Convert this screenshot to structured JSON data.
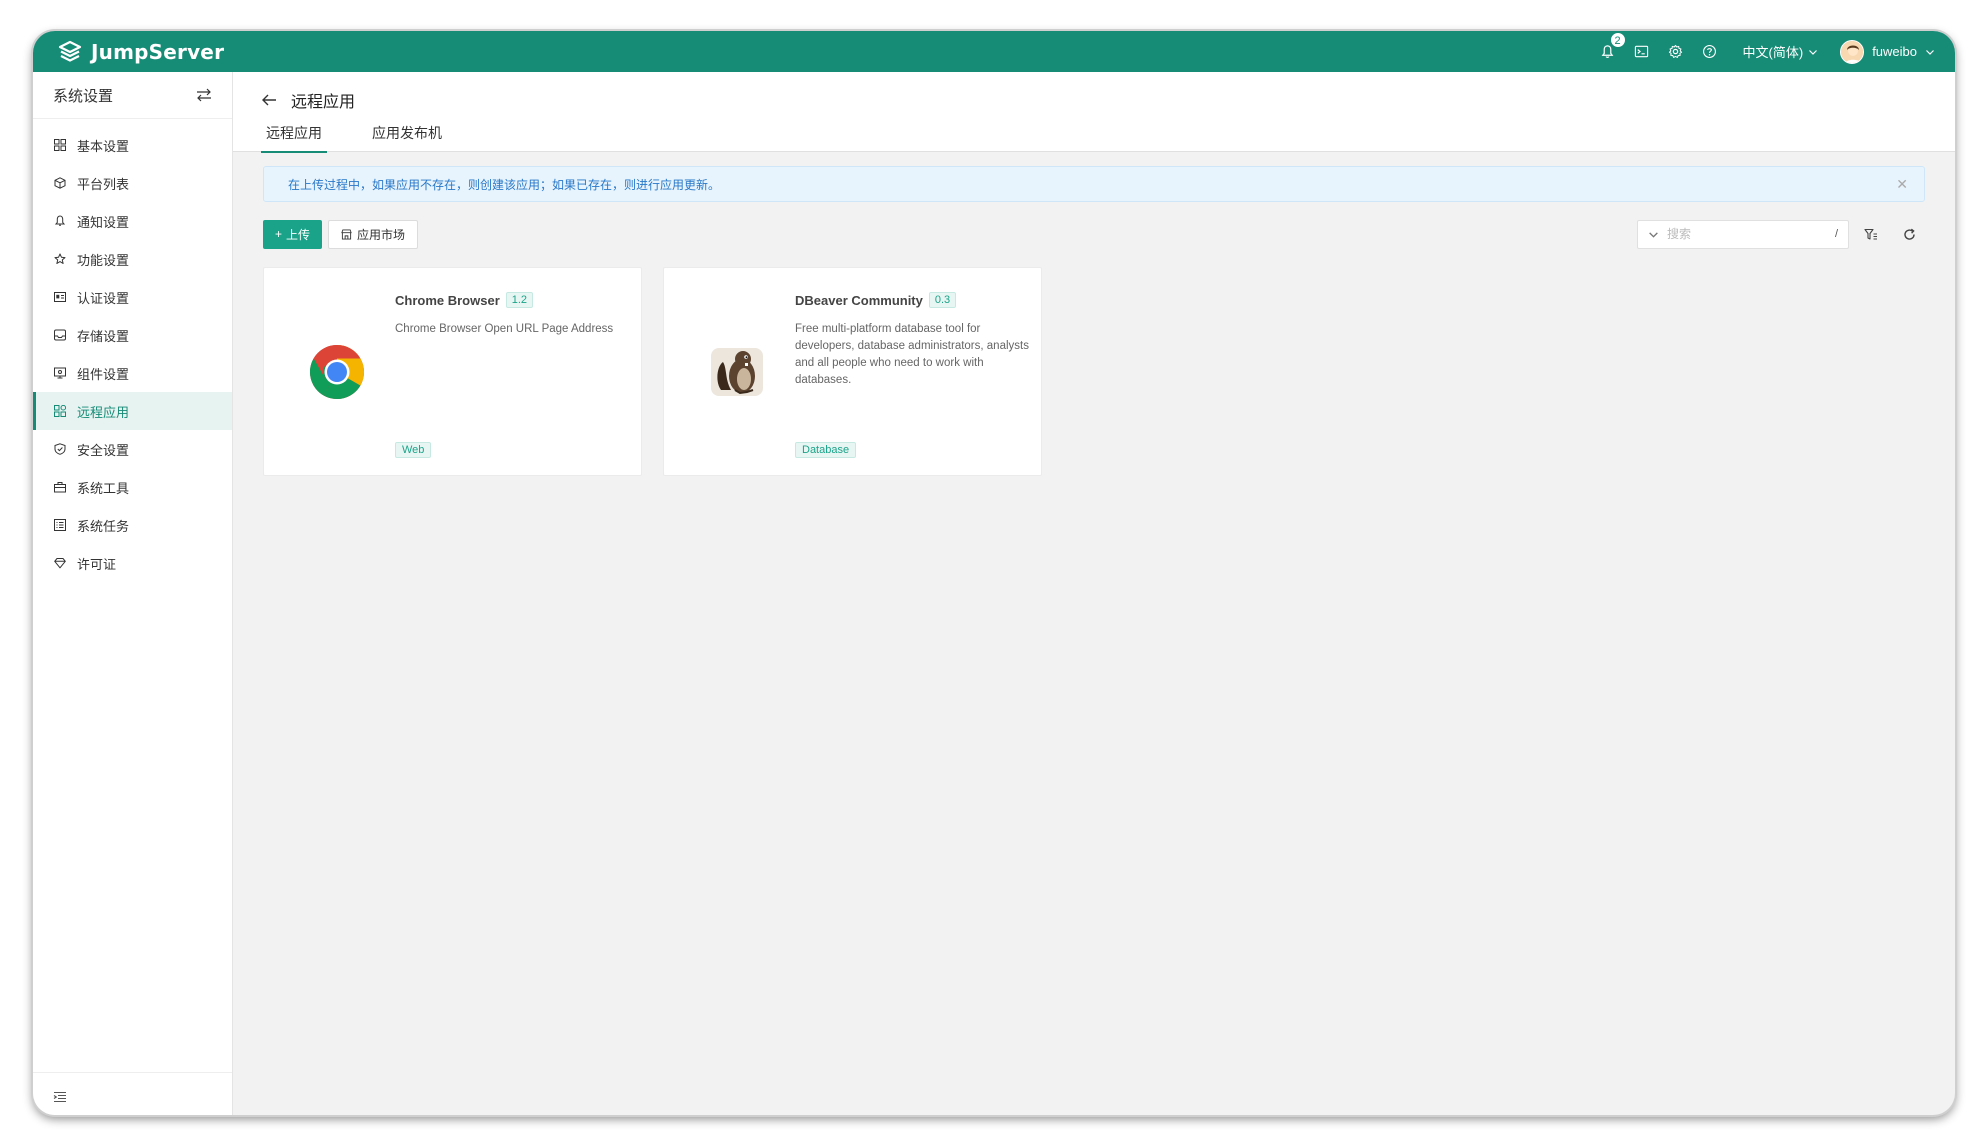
{
  "app": {
    "brand": "JumpServer"
  },
  "topbar": {
    "notification_count": "2",
    "language": "中文(简体)",
    "username": "fuweibo",
    "icons": [
      "bell-icon",
      "terminal-icon",
      "gear-icon",
      "help-icon"
    ]
  },
  "sidebar": {
    "title": "系统设置",
    "items": [
      {
        "label": "基本设置",
        "icon": "grid-icon"
      },
      {
        "label": "平台列表",
        "icon": "cube-icon"
      },
      {
        "label": "通知设置",
        "icon": "bell-icon"
      },
      {
        "label": "功能设置",
        "icon": "star-icon"
      },
      {
        "label": "认证设置",
        "icon": "id-card-icon"
      },
      {
        "label": "存储设置",
        "icon": "inbox-icon"
      },
      {
        "label": "组件设置",
        "icon": "monitor-icon"
      },
      {
        "label": "远程应用",
        "icon": "apps-icon",
        "active": true
      },
      {
        "label": "安全设置",
        "icon": "shield-icon"
      },
      {
        "label": "系统工具",
        "icon": "toolbox-icon"
      },
      {
        "label": "系统任务",
        "icon": "tasks-icon"
      },
      {
        "label": "许可证",
        "icon": "diamond-icon"
      }
    ]
  },
  "header": {
    "title": "远程应用",
    "tabs": [
      {
        "label": "远程应用",
        "active": true
      },
      {
        "label": "应用发布机",
        "active": false
      }
    ]
  },
  "alert": {
    "text": "在上传过程中，如果应用不存在，则创建该应用；如果已存在，则进行应用更新。"
  },
  "toolbar": {
    "upload_label": "上传",
    "market_label": "应用市场",
    "search_placeholder": "搜索",
    "search_shortcut": "/"
  },
  "cards": [
    {
      "name": "Chrome Browser",
      "version": "1.2",
      "description": "Chrome Browser Open URL Page Address",
      "tag": "Web"
    },
    {
      "name": "DBeaver Community",
      "version": "0.3",
      "description": "Free multi-platform database tool for developers, database administrators, analysts and all people who need to work with databases.",
      "tag": "Database"
    }
  ],
  "colors": {
    "brand": "#168b76",
    "primary_button": "#1ba389",
    "alert_text": "#2878c8",
    "alert_bg": "#e8f4fd"
  }
}
